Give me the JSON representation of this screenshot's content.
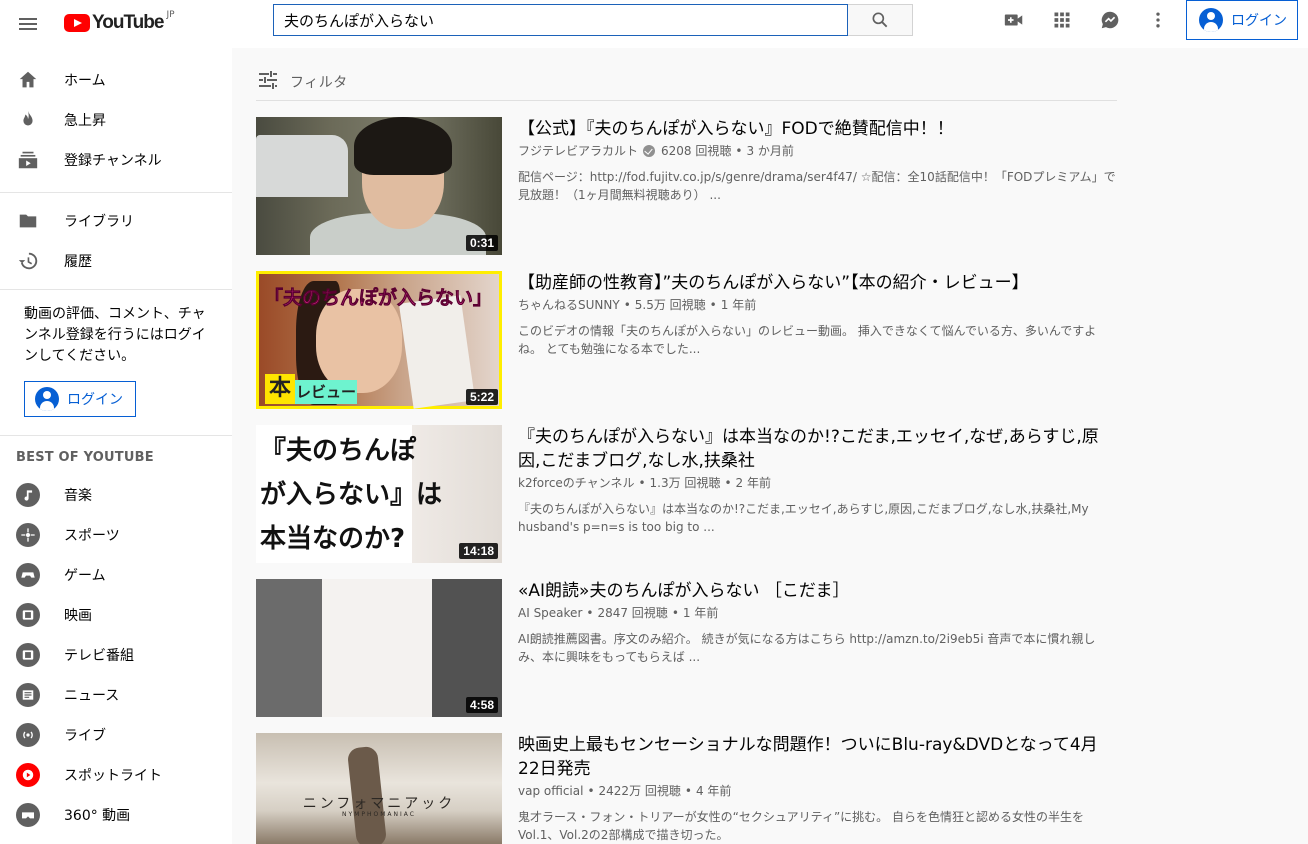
{
  "header": {
    "logo_text": "YouTube",
    "logo_region": "JP",
    "search_value": "夫のちんぽが入らない",
    "login_label": "ログイン"
  },
  "sidebar": {
    "main_items": [
      {
        "label": "ホーム",
        "icon": "home-icon"
      },
      {
        "label": "急上昇",
        "icon": "fire-icon"
      },
      {
        "label": "登録チャンネル",
        "icon": "subscriptions-icon"
      }
    ],
    "library_items": [
      {
        "label": "ライブラリ",
        "icon": "folder-icon"
      },
      {
        "label": "履歴",
        "icon": "history-icon"
      }
    ],
    "signin_prompt": "動画の評価、コメント、チャンネル登録を行うにはログインしてください。",
    "signin_button": "ログイン",
    "section_title": "BEST OF YOUTUBE",
    "categories": [
      {
        "label": "音楽",
        "icon": "music-icon"
      },
      {
        "label": "スポーツ",
        "icon": "sports-icon"
      },
      {
        "label": "ゲーム",
        "icon": "gaming-icon"
      },
      {
        "label": "映画",
        "icon": "movie-icon"
      },
      {
        "label": "テレビ番組",
        "icon": "tv-icon"
      },
      {
        "label": "ニュース",
        "icon": "news-icon"
      },
      {
        "label": "ライブ",
        "icon": "live-icon"
      },
      {
        "label": "スポットライト",
        "icon": "spotlight-icon"
      },
      {
        "label": "360° 動画",
        "icon": "vr-icon"
      }
    ]
  },
  "filter_label": "フィルタ",
  "results": [
    {
      "title": "【公式】『夫のちんぽが入らない』FODで絶賛配信中！！",
      "channel": "フジテレビアラカルト",
      "verified": true,
      "views": "6208 回視聴",
      "age": "3 か月前",
      "description": "配信ページ：http://fod.fujitv.co.jp/s/genre/drama/ser4f47/ ☆配信：全10話配信中！「FODプレミアム」で見放題！（1ヶ月間無料視聴あり） ...",
      "duration": "0:31"
    },
    {
      "title": "【助産師の性教育】”夫のちんぽが入らない”【本の紹介・レビュー】",
      "channel": "ちゃんねるSUNNY",
      "verified": false,
      "views": "5.5万 回視聴",
      "age": "1 年前",
      "description": "このビデオの情報「夫のちんぽが入らない」のレビュー動画。 挿入できなくて悩んでいる方、多いんですよね。 とても勉強になる本でした...",
      "duration": "5:22",
      "thumb_title": "「夫のちんぽが入らない」",
      "thumb_hon": "本",
      "thumb_review": "レビュー"
    },
    {
      "title": "『夫のちんぽが入らない』は本当なのか!?こだま,エッセイ,なぜ,あらすじ,原因,こだまブログ,なし水,扶桑社",
      "channel": "k2forceのチャンネル",
      "verified": false,
      "views": "1.3万 回視聴",
      "age": "2 年前",
      "description": "『夫のちんぽが入らない』は本当なのか!?こだま,エッセイ,あらすじ,原因,こだまブログ,なし水,扶桑社,My husband's p=n=s is too big to ...",
      "duration": "14:18",
      "thumb_lines": [
        "『夫のちんぽ",
        "が入らない』は",
        "本当なのか?"
      ]
    },
    {
      "title": "«AI朗読»夫のちんぽが入らない ［こだま］",
      "channel": "AI Speaker",
      "verified": false,
      "views": "2847 回視聴",
      "age": "1 年前",
      "description": "AI朗読推薦図書。序文のみ紹介。 続きが気になる方はこちら http://amzn.to/2i9eb5i 音声で本に慣れ親しみ、本に興味をもってもらえば ...",
      "duration": "4:58"
    },
    {
      "title": "映画史上最もセンセーショナルな問題作！ついにBlu-ray&DVDとなって4月22日発売",
      "channel": "vap official",
      "verified": false,
      "views": "2422万 回視聴",
      "age": "4 年前",
      "description": "鬼才ラース・フォン・トリアーが女性の“セクシュアリティ”に挑む。 自らを色情狂と認める女性の半生をVol.1、Vol.2の2部構成で描き切った。",
      "thumb_caption": "ニンフォマニアック",
      "thumb_caption_en": "NYMPHOMANIAC"
    }
  ],
  "colors": {
    "brand_red": "#ff0000",
    "link_blue": "#065fd4",
    "text_secondary": "#606060"
  }
}
